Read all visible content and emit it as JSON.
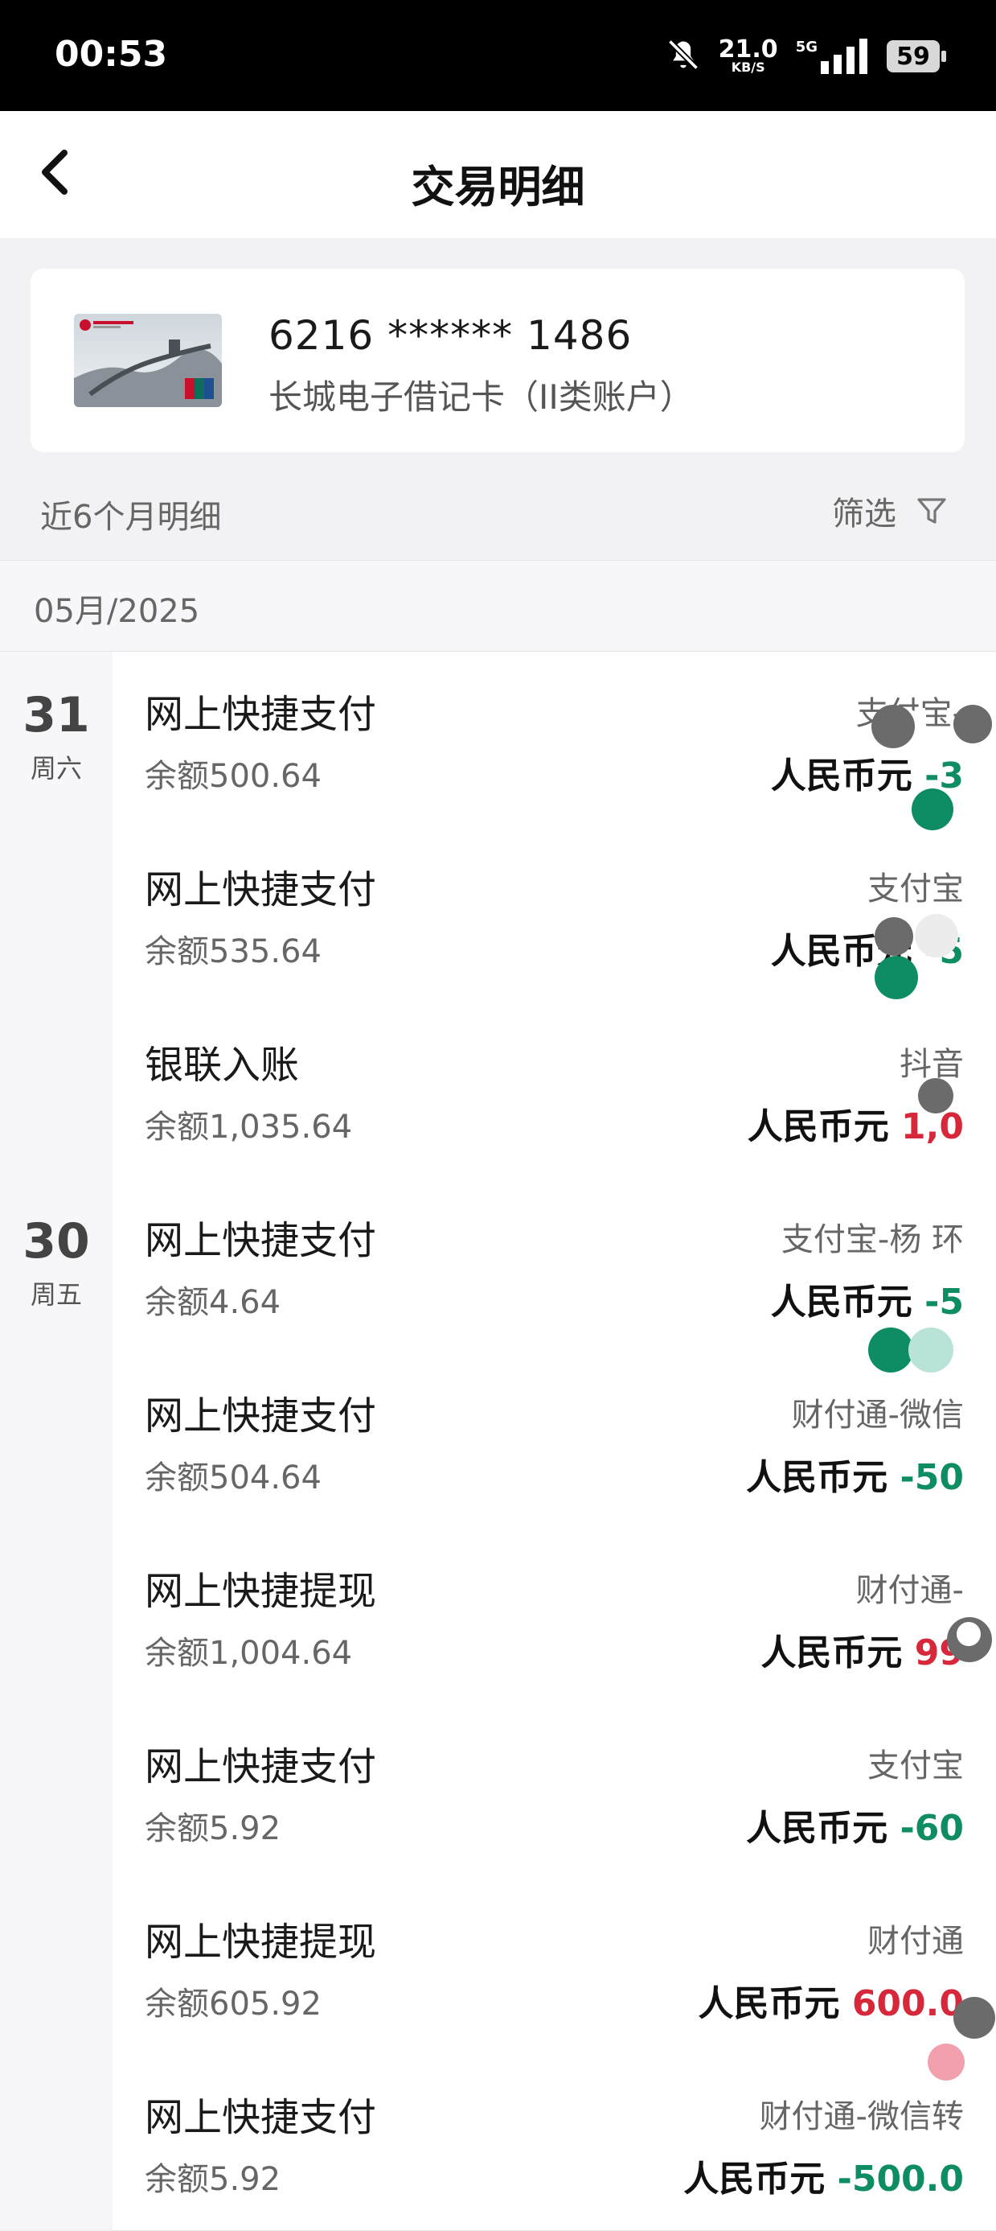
{
  "status_bar": {
    "time": "00:53",
    "net_speed": "21.0",
    "net_unit": "KB/S",
    "signal": "5G",
    "battery": "59"
  },
  "nav": {
    "title": "交易明细",
    "back_icon": "chevron-left-icon"
  },
  "card": {
    "number": "6216 ****** 1486",
    "type": "长城电子借记卡（II类账户）"
  },
  "summary": {
    "label": "近6个月明细",
    "filter_label": "筛选",
    "filter_icon": "funnel-icon"
  },
  "month": "05月/2025",
  "days": [
    {
      "day": "31",
      "weekday": "周六"
    },
    {
      "day": "30",
      "weekday": "周五"
    }
  ],
  "transactions": [
    {
      "title": "网上快捷支付",
      "balance": "余额500.64",
      "party": "支付宝-",
      "currency": "人民币元",
      "amount": "-3",
      "direction": "out"
    },
    {
      "title": "网上快捷支付",
      "balance": "余额535.64",
      "party": "支付宝",
      "currency": "人民币元",
      "amount": "-5",
      "direction": "out"
    },
    {
      "title": "银联入账",
      "balance": "余额1,035.64",
      "party": "抖音",
      "currency": "人民币元",
      "amount": "1,0",
      "direction": "in"
    },
    {
      "title": "网上快捷支付",
      "balance": "余额4.64",
      "party": "支付宝-杨 环",
      "currency": "人民币元",
      "amount": "-5",
      "direction": "out"
    },
    {
      "title": "网上快捷支付",
      "balance": "余额504.64",
      "party": "财付通-微信",
      "currency": "人民币元",
      "amount": "-50",
      "direction": "out"
    },
    {
      "title": "网上快捷提现",
      "balance": "余额1,004.64",
      "party": "财付通-",
      "currency": "人民币元",
      "amount": "99",
      "direction": "in"
    },
    {
      "title": "网上快捷支付",
      "balance": "余额5.92",
      "party": "支付宝",
      "currency": "人民币元",
      "amount": "-60",
      "direction": "out"
    },
    {
      "title": "网上快捷提现",
      "balance": "余额605.92",
      "party": "财付通",
      "currency": "人民币元",
      "amount": "600.0",
      "direction": "in"
    },
    {
      "title": "网上快捷支付",
      "balance": "余额5.92",
      "party": "财付通-微信转",
      "currency": "人民币元",
      "amount": "-500.0",
      "direction": "out"
    }
  ],
  "colors": {
    "outflow": "#0e8c63",
    "inflow": "#d6283a",
    "header_bg": "#000000"
  }
}
